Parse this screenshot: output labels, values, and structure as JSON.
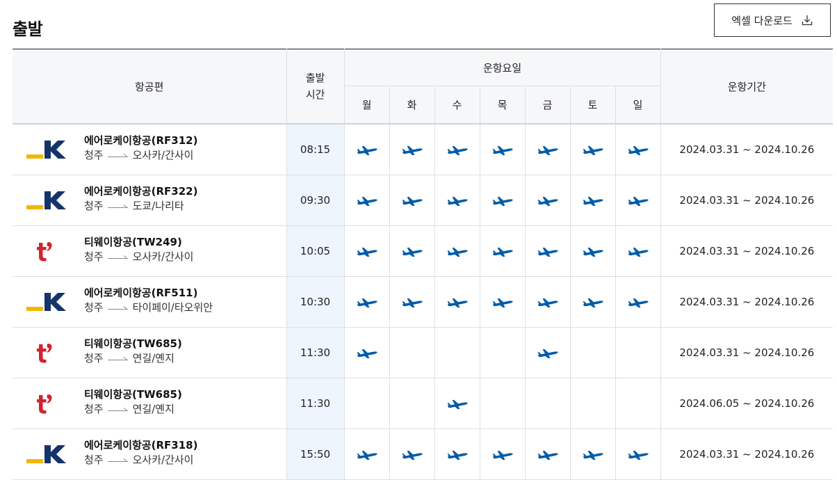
{
  "page": {
    "title": "출발",
    "excel_download_label": "엑셀 다운로드"
  },
  "colors": {
    "plane": "#005ca8",
    "rk_yellow": "#f2b705",
    "rk_navy": "#14346b",
    "tway_red": "#d3232f",
    "time_bg": "#eef5fd"
  },
  "headers": {
    "flight": "항공편",
    "departure_time": "출발\n시간",
    "operating_days": "운항요일",
    "days": [
      "월",
      "화",
      "수",
      "목",
      "금",
      "토",
      "일"
    ],
    "period": "운항기간"
  },
  "flights": [
    {
      "airline_logo": "aero-k-logo",
      "name": "에어로케이항공(RF312)",
      "origin": "청주",
      "destination": "오사카/간사이",
      "time": "08:15",
      "days": [
        true,
        true,
        true,
        true,
        true,
        true,
        true
      ],
      "period": "2024.03.31 ~ 2024.10.26"
    },
    {
      "airline_logo": "aero-k-logo",
      "name": "에어로케이항공(RF322)",
      "origin": "청주",
      "destination": "도쿄/나리타",
      "time": "09:30",
      "days": [
        true,
        true,
        true,
        true,
        true,
        true,
        true
      ],
      "period": "2024.03.31 ~ 2024.10.26"
    },
    {
      "airline_logo": "tway-logo",
      "name": "티웨이항공(TW249)",
      "origin": "청주",
      "destination": "오사카/간사이",
      "time": "10:05",
      "days": [
        true,
        true,
        true,
        true,
        true,
        true,
        true
      ],
      "period": "2024.03.31 ~ 2024.10.26"
    },
    {
      "airline_logo": "aero-k-logo",
      "name": "에어로케이항공(RF511)",
      "origin": "청주",
      "destination": "타이페이/타오위안",
      "time": "10:30",
      "days": [
        true,
        true,
        true,
        true,
        true,
        true,
        true
      ],
      "period": "2024.03.31 ~ 2024.10.26"
    },
    {
      "airline_logo": "tway-logo",
      "name": "티웨이항공(TW685)",
      "origin": "청주",
      "destination": "연길/옌지",
      "time": "11:30",
      "days": [
        true,
        false,
        false,
        false,
        true,
        false,
        false
      ],
      "period": "2024.03.31 ~ 2024.10.26"
    },
    {
      "airline_logo": "tway-logo",
      "name": "티웨이항공(TW685)",
      "origin": "청주",
      "destination": "연길/옌지",
      "time": "11:30",
      "days": [
        false,
        false,
        true,
        false,
        false,
        false,
        false
      ],
      "period": "2024.06.05 ~ 2024.10.26"
    },
    {
      "airline_logo": "aero-k-logo",
      "name": "에어로케이항공(RF318)",
      "origin": "청주",
      "destination": "오사카/간사이",
      "time": "15:50",
      "days": [
        true,
        true,
        true,
        true,
        true,
        true,
        true
      ],
      "period": "2024.03.31 ~ 2024.10.26"
    }
  ]
}
